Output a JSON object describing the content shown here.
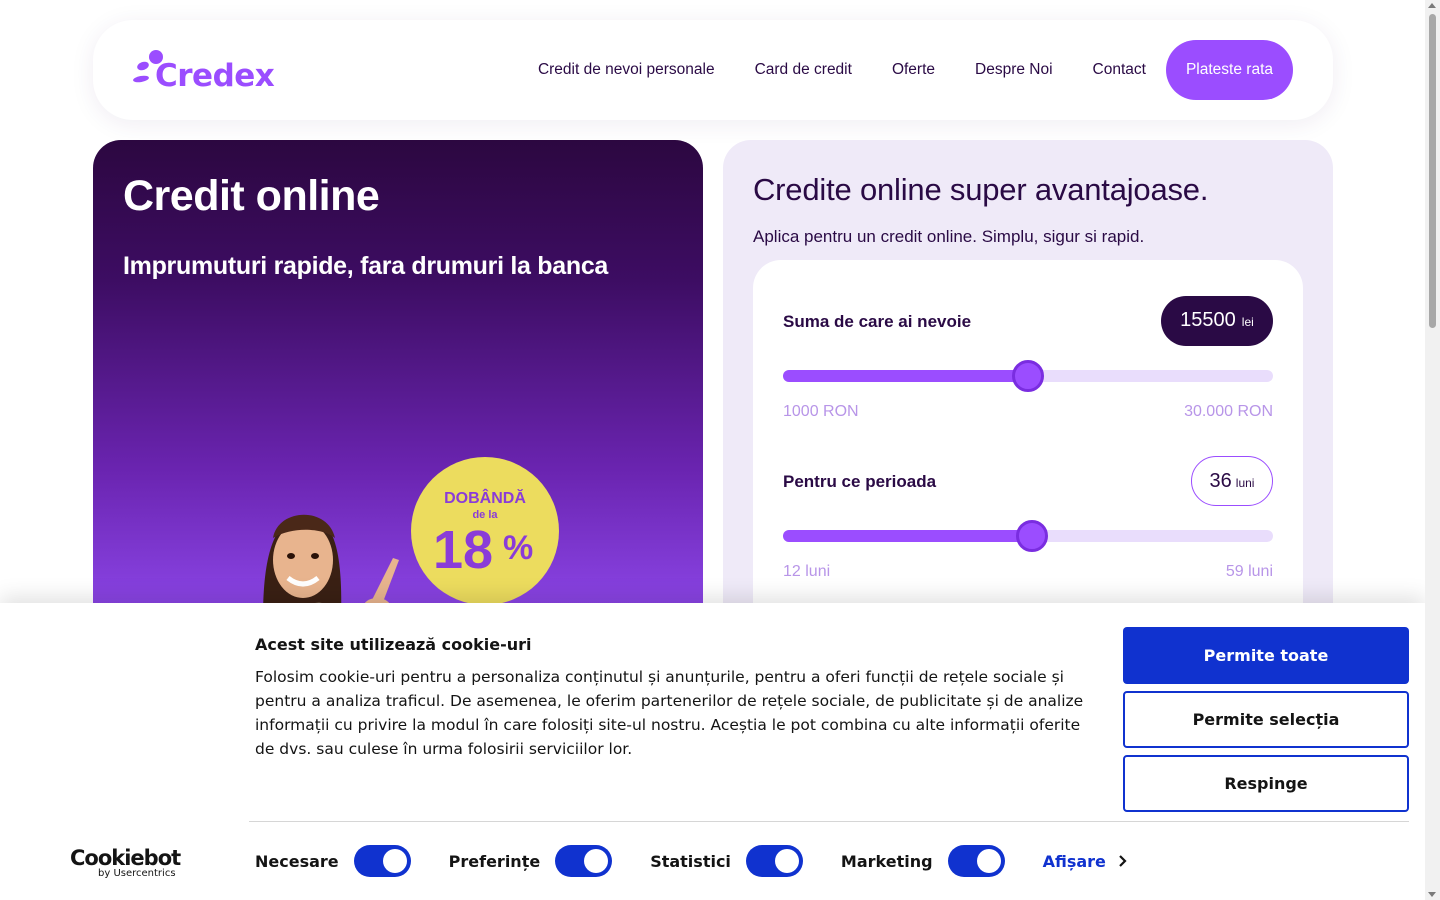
{
  "header": {
    "logo_text": "Credex",
    "nav": [
      "Credit de nevoi personale",
      "Card de credit",
      "Oferte",
      "Despre Noi",
      "Contact"
    ],
    "pay_button": "Plateste rata"
  },
  "hero": {
    "title": "Credit online",
    "subtitle": "Imprumuturi rapide, fara drumuri la banca",
    "badge": {
      "line1": "DOBÂNDĂ",
      "line2": "de la",
      "value": "18",
      "unit": "%"
    }
  },
  "calculator": {
    "title": "Credite online super avantajoase.",
    "subtitle": "Aplica pentru un credit online. Simplu, sigur si rapid.",
    "amount": {
      "label": "Suma de care ai nevoie",
      "value": "15500",
      "unit": "lei",
      "min_label": "1000 RON",
      "max_label": "30.000 RON",
      "level": 0.5
    },
    "period": {
      "label": "Pentru ce perioada",
      "value": "36",
      "unit": "luni",
      "min_label": "12 luni",
      "max_label": "59 luni",
      "level": 0.508
    }
  },
  "cookie": {
    "title": "Acest site utilizează cookie-uri",
    "text": "Folosim cookie-uri pentru a personaliza conținutul și anunțurile, pentru a oferi funcții de rețele sociale și pentru a analiza traficul. De asemenea, le oferim partenerilor de rețele sociale, de publicitate și de analize informații cu privire la modul în care folosiți site-ul nostru. Aceștia le pot combina cu alte informații oferite de dvs. sau culese în urma folosirii serviciilor lor.",
    "allow_all": "Permite toate",
    "allow_selection": "Permite selecția",
    "reject": "Respinge",
    "toggles": [
      {
        "label": "Necesare",
        "on": true
      },
      {
        "label": "Preferințe",
        "on": true
      },
      {
        "label": "Statistici",
        "on": true
      },
      {
        "label": "Marketing",
        "on": true
      }
    ],
    "show_details": "Afișare",
    "brand": "Cookiebot",
    "brand_sub": "by Usercentrics"
  },
  "colors": {
    "accent": "#9b4dff",
    "dark": "#2a0a45",
    "cookie_blue": "#1032cf",
    "badge_yellow": "#ecdc5e"
  }
}
